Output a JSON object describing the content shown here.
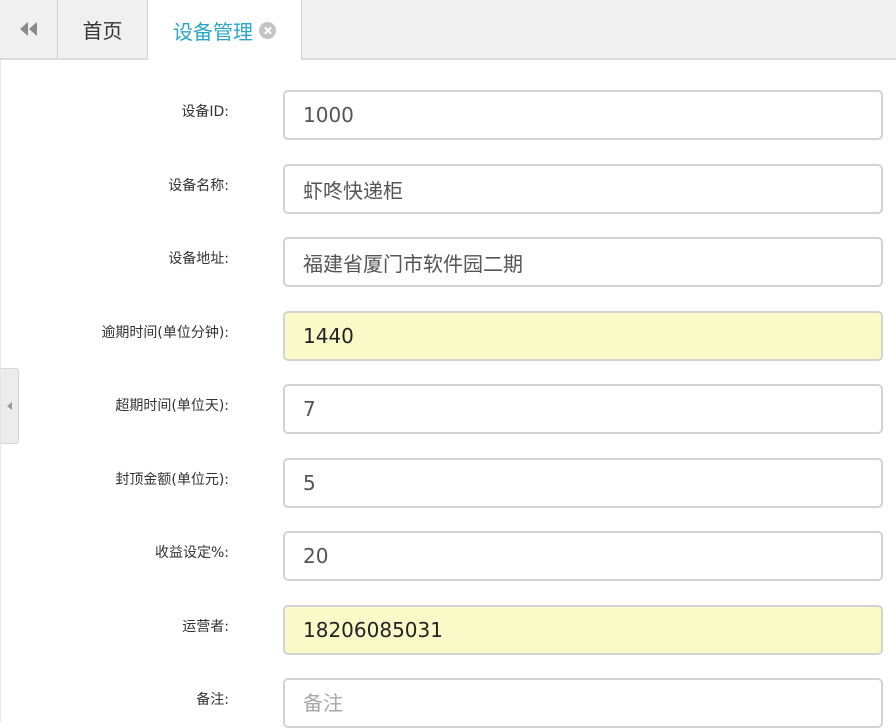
{
  "tabs": {
    "back_icon": "double-chevron-left-icon",
    "home_label": "首页",
    "active_label": "设备管理",
    "close_icon": "close-circle-icon"
  },
  "colors": {
    "active_tab_text": "#2aa7c7",
    "autofill_background": "#fafac8",
    "field_border": "#d3d3d3"
  },
  "form": {
    "device_id": {
      "label": "设备ID:",
      "value": "1000"
    },
    "device_name": {
      "label": "设备名称:",
      "value": "虾咚快递柜"
    },
    "device_address": {
      "label": "设备地址:",
      "value": "福建省厦门市软件园二期"
    },
    "overdue_minutes": {
      "label": "逾期时间(单位分钟):",
      "value": "1440"
    },
    "overtime_days": {
      "label": "超期时间(单位天):",
      "value": "7"
    },
    "cap_amount": {
      "label": "封顶金额(单位元):",
      "value": "5"
    },
    "revenue_percent": {
      "label": "收益设定%:",
      "value": "20"
    },
    "operator": {
      "label": "运营者:",
      "value": "18206085031"
    },
    "remark": {
      "label": "备注:",
      "value": "",
      "placeholder": "备注"
    }
  }
}
